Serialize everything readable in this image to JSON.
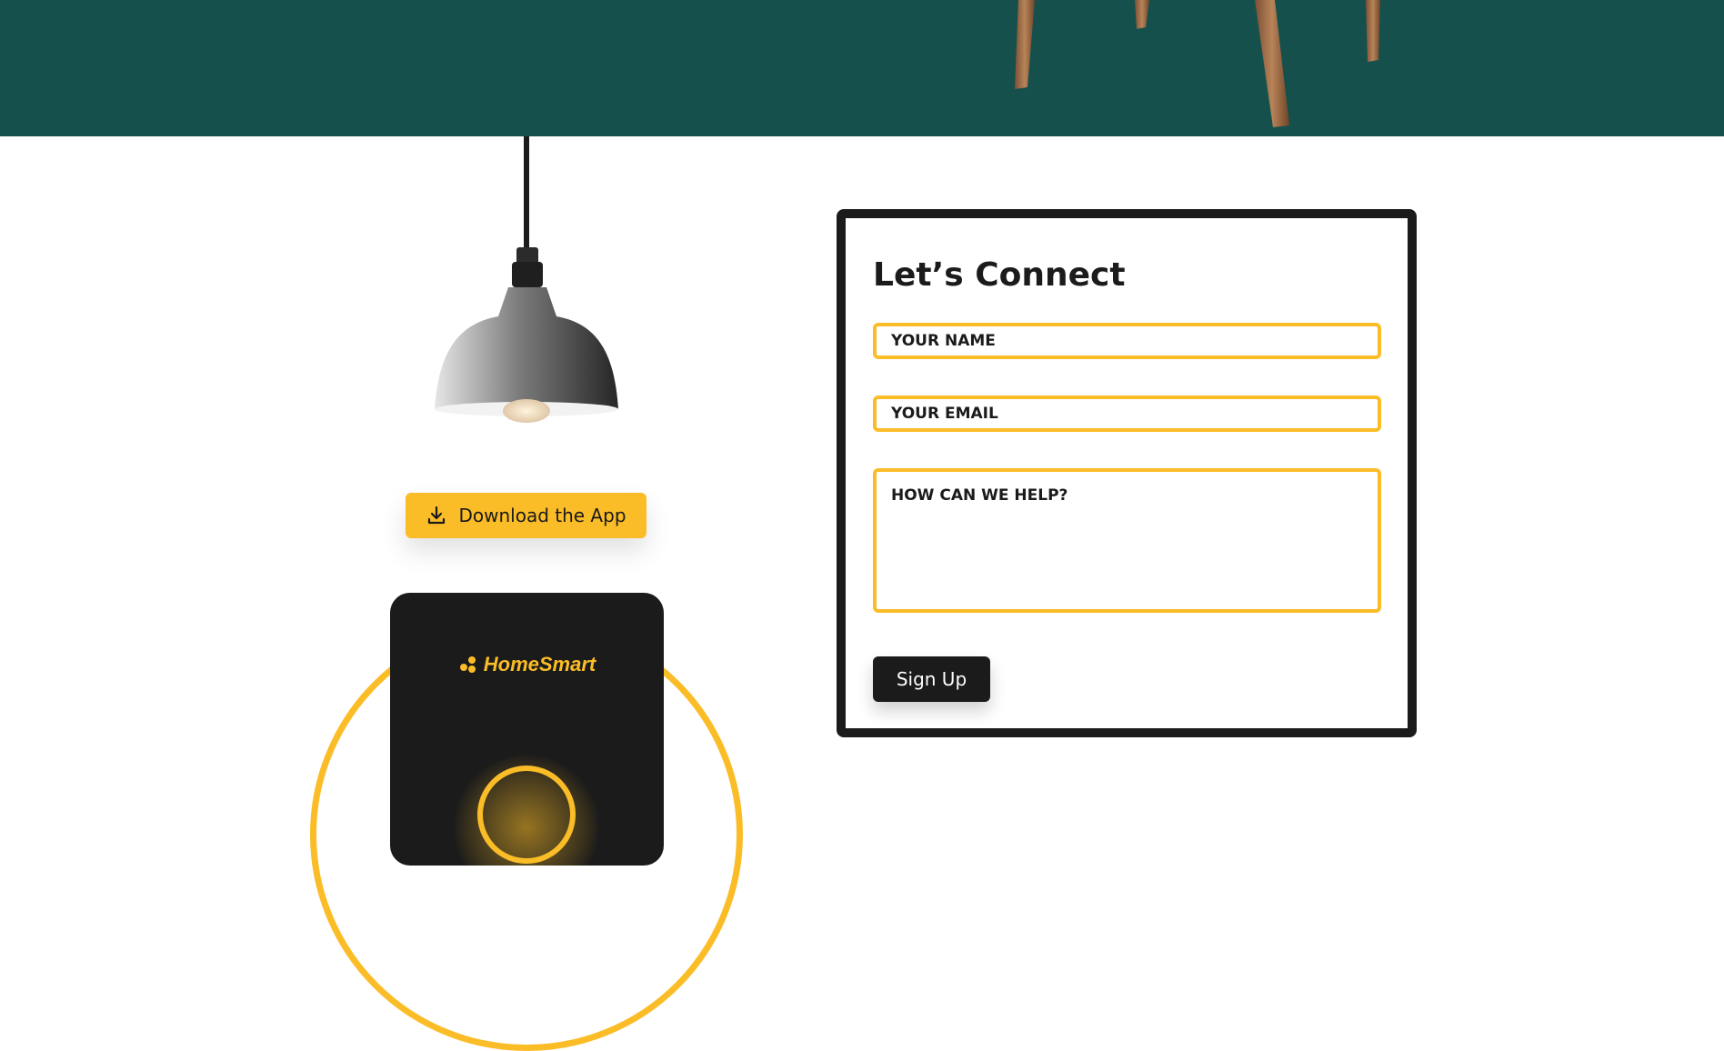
{
  "colors": {
    "banner": "#16504c",
    "accent": "#fbbd27",
    "dark": "#1b1b1b"
  },
  "images": {
    "banner_photo": "wooden-chair-legs",
    "lamp_photo": "pendant-lamp"
  },
  "hero": {
    "download_button": {
      "label": "Download the App",
      "icon": "download-icon"
    }
  },
  "phone": {
    "brand": "HomeSmart",
    "brand_icon": "homesmart-logo-icon"
  },
  "contact_form": {
    "title": "Let’s Connect",
    "name_placeholder": "YOUR NAME",
    "email_placeholder": "YOUR EMAIL",
    "message_placeholder": "HOW CAN WE HELP?",
    "submit_label": "Sign Up"
  }
}
